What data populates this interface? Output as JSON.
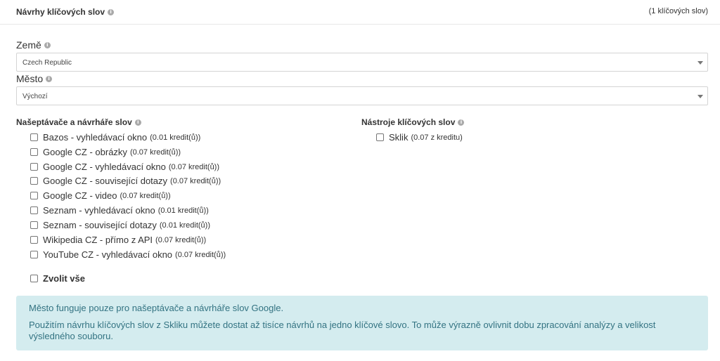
{
  "header": {
    "title": "Návrhy klíčových slov",
    "count": "(1 klíčových slov)"
  },
  "country": {
    "label": "Země",
    "value": "Czech Republic"
  },
  "city": {
    "label": "Město",
    "value": "Výchozí"
  },
  "suggesters": {
    "title": "Našeptávače a návrháře slov",
    "items": [
      {
        "label": "Bazos - vyhledávací okno",
        "price": "(0.01 kredit(ů))"
      },
      {
        "label": "Google CZ - obrázky",
        "price": "(0.07 kredit(ů))"
      },
      {
        "label": "Google CZ - vyhledávací okno",
        "price": "(0.07 kredit(ů))"
      },
      {
        "label": "Google CZ - související dotazy",
        "price": "(0.07 kredit(ů))"
      },
      {
        "label": "Google CZ - video",
        "price": "(0.07 kredit(ů))"
      },
      {
        "label": "Seznam - vyhledávací okno",
        "price": "(0.01 kredit(ů))"
      },
      {
        "label": "Seznam - související dotazy",
        "price": "(0.01 kredit(ů))"
      },
      {
        "label": "Wikipedia CZ - přímo z API",
        "price": "(0.07 kredit(ů))"
      },
      {
        "label": "YouTube CZ - vyhledávací okno",
        "price": "(0.07 kredit(ů))"
      }
    ],
    "select_all": "Zvolit vše"
  },
  "tools": {
    "title": "Nástroje klíčových slov",
    "items": [
      {
        "label": "Sklik",
        "price": "(0.07 z kreditu)"
      }
    ]
  },
  "alert": {
    "line1": "Město funguje pouze pro našeptávače a návrháře slov Google.",
    "line2": "Použitím návrhu klíčových slov z Skliku můžete dostat až tisíce návrhů na jedno klíčové slovo. To může výrazně ovlivnit dobu zpracování analýzy a velikost výsledného souboru."
  },
  "icons": {
    "info": "info-icon",
    "dropdown": "chevron-down-icon"
  },
  "colors": {
    "alert_bg": "#d4ecef",
    "alert_text": "#337382"
  }
}
